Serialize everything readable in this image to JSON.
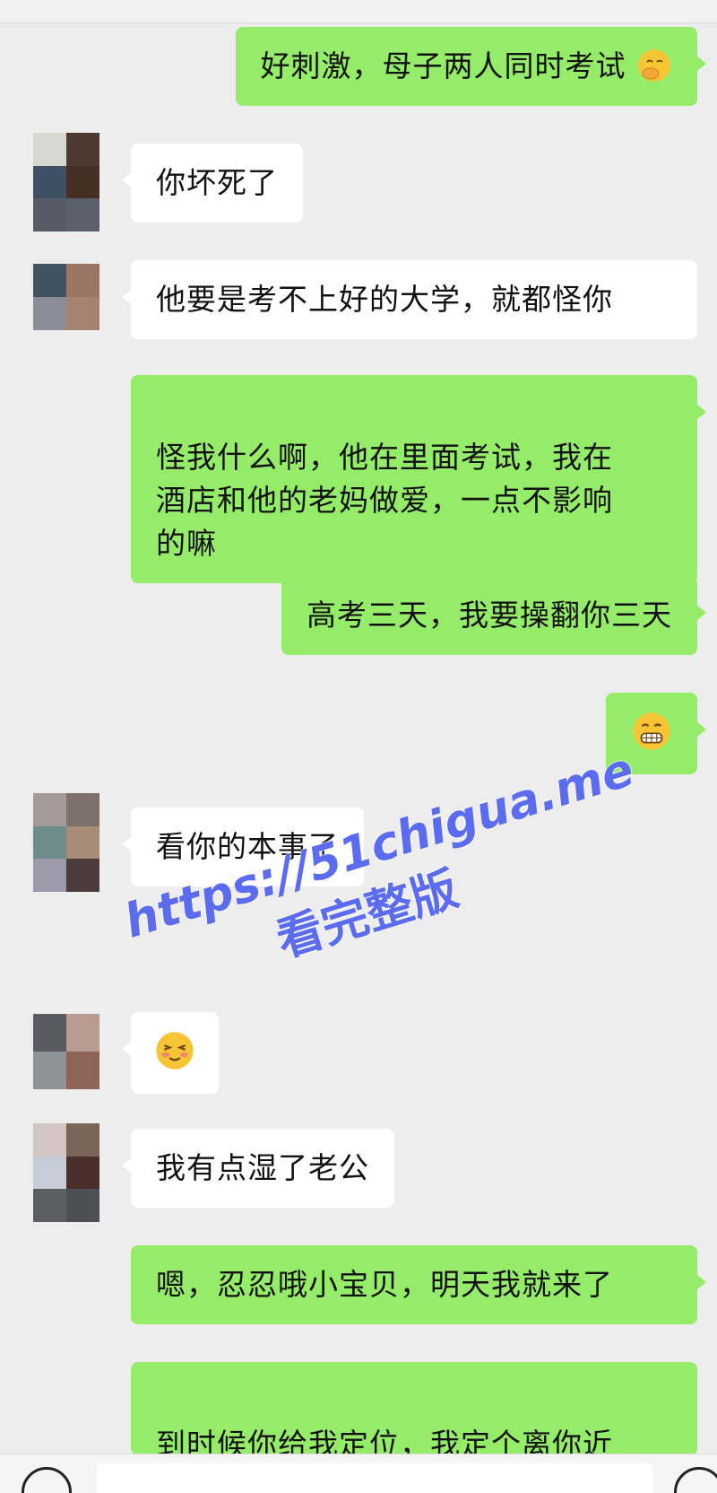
{
  "messages": [
    {
      "side": "out",
      "text": "好刺激，母子两人同时考试",
      "emoji": "hand-over-mouth-emoji"
    },
    {
      "side": "in",
      "text": "你坏死了"
    },
    {
      "side": "in",
      "text": "他要是考不上好的大学，就都怪你"
    },
    {
      "side": "out",
      "text": "怪我什么啊，他在里面考试，我在\n酒店和他的老妈做爱，一点不影响\n的嘛"
    },
    {
      "side": "out",
      "text": "高考三天，我要操翻你三天"
    },
    {
      "side": "out",
      "emoji": "grimacing-emoji"
    },
    {
      "side": "in",
      "text": "看你的本事了"
    },
    {
      "side": "in",
      "emoji": "blushing-emoji"
    },
    {
      "side": "in",
      "text": "我有点湿了老公"
    },
    {
      "side": "out",
      "text": "嗯，忍忍哦小宝贝，明天我就来了"
    },
    {
      "side": "out",
      "text": "到时候你给我定位，我定个离你近\n的位置"
    }
  ],
  "watermark": {
    "line1": "https://51chigua.me",
    "line2": "看完整版",
    "color": "#5b6cf0"
  },
  "colors": {
    "outgoing_bubble": "#95ec69",
    "incoming_bubble": "#ffffff",
    "background": "#ededed"
  }
}
